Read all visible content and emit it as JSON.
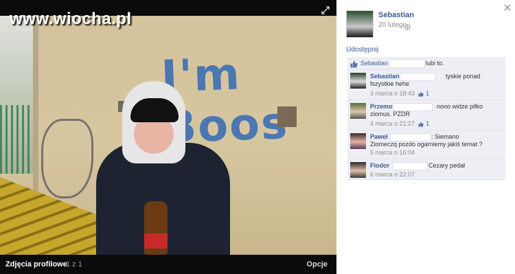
{
  "watermark": "www.wiocha.pl",
  "photo": {
    "graffiti": "I'm Boos",
    "album_title": "Zdjęcia profilowe",
    "album_count": "1 z 1",
    "options": "Opcje"
  },
  "owner": {
    "name": "Sebastian",
    "date": "20 lutego"
  },
  "share": "Udostępnij",
  "likes": {
    "name": "Sebastian",
    "suffix": "lubi to."
  },
  "comments": [
    {
      "name": "Sebastian",
      "text": "tyskie ponad fszystkie hehe",
      "time": "3 marca o 18:43",
      "likes": "1"
    },
    {
      "name": "Przemo",
      "text": "nono widze pifko ziomus. PZDR",
      "time": "4 marca o 21:27",
      "likes": "1"
    },
    {
      "name": "Paweł",
      "text": ": Siemano Ziomeczq pozdo ogarniemy jakiś temat ?",
      "time": "5 marca o 16:04",
      "likes": ""
    },
    {
      "name": "Fiodor",
      "text": "Cezary pedał",
      "time": "6 marca o 22:07",
      "likes": ""
    }
  ],
  "colors": {
    "link": "#3b5998",
    "panel_bg": "#edeff4",
    "photo_bg": "#0b0b0b"
  },
  "icons": [
    "expand-icon",
    "close-icon",
    "globe-icon",
    "like-icon"
  ]
}
